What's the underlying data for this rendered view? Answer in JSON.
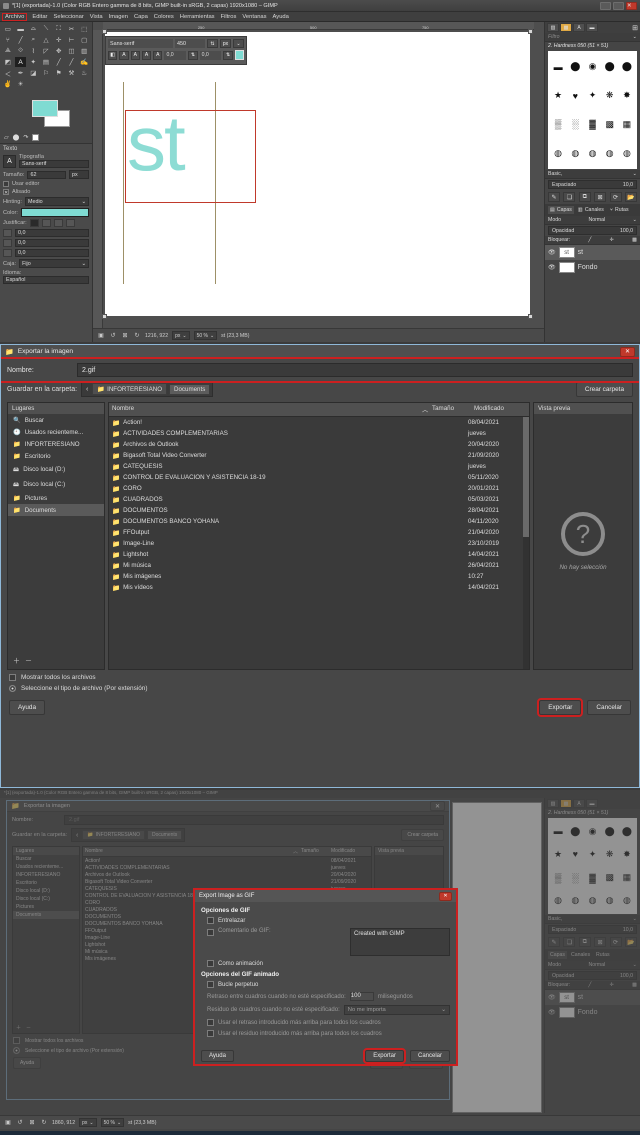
{
  "gimp": {
    "title": "*[1] (exportada)-1.0 (Color RGB Entero gamma de 8 bits, GIMP built-in sRGB, 2 capas) 1920x1080 – GIMP",
    "menus": [
      "Archivo",
      "Editar",
      "Seleccionar",
      "Vista",
      "Imagen",
      "Capa",
      "Colores",
      "Herramientas",
      "Filtros",
      "Ventanas",
      "Ayuda"
    ],
    "highlight_menu": "Archivo",
    "tools": [
      "▭",
      "▬",
      "⬭",
      "⟍",
      "⬚",
      "✂",
      "⛶",
      "⧉",
      "╱",
      "🔍",
      "△",
      "✛",
      "⊢",
      "□",
      "⟁",
      "✎",
      "⌇",
      "↷",
      "✥",
      "◫",
      "▥",
      "⬓",
      "◩",
      "⬛",
      "A",
      "✦",
      "▤",
      "╱",
      "╱",
      "✒",
      "＜",
      "✍",
      "◪",
      "⚐",
      "⚑",
      "⚒",
      "✆",
      "♨",
      "✌"
    ],
    "active_tool": "A",
    "foreground_color": "#7fdbd2",
    "background_color": "#ffffff",
    "tooloptions": {
      "header": "Texto",
      "font_label": "Tipografía",
      "font_value": "Sans-serif",
      "size_label": "Tamaño:",
      "size_value": "62",
      "size_unit": "px",
      "use_editor": "Usar editor",
      "antialias": "Alisado",
      "hinting_label": "Hinting:",
      "hinting_value": "Medio",
      "color_label": "Color:",
      "color_value": "#7fdbd2",
      "justify_label": "Justificar:",
      "indent": "0,0",
      "line_spacing": "0,0",
      "letter_spacing": "0,0",
      "box_label": "Caja:",
      "box_value": "Fijo",
      "language_label": "Idioma:",
      "language_value": "Español"
    },
    "canvas": {
      "ruler_ticks_h": [
        "250",
        "500",
        "750"
      ],
      "text_content": "st",
      "text_color": "#8ddcd4",
      "ontool": {
        "font": "Sans-serif",
        "size": "450",
        "unit": "px",
        "btns": [
          "B",
          "A",
          "A",
          "A",
          "A"
        ],
        "num1": "0,0",
        "num2": "0,0",
        "swatch": "#7fdbd2"
      }
    },
    "statusbar": {
      "coords": "1216, 922",
      "unit": "px",
      "zoom": "50 %",
      "info": "st (23,3 MB)"
    },
    "dock": {
      "brush_name": "2. Hardness 050 (51 × 51)",
      "filter_placeholder": "Filtro",
      "tag_value": "Basic,",
      "spacing_label": "Espaciado",
      "spacing_value": "10,0",
      "tabs": [
        "Capas",
        "Canales",
        "Rutas"
      ],
      "mode_label": "Modo",
      "mode_value": "Normal",
      "opacity_label": "Opacidad",
      "opacity_value": "100,0",
      "lock_label": "Bloquear:",
      "layers": [
        {
          "name": "st",
          "selected": true
        },
        {
          "name": "Fondo",
          "selected": false
        }
      ]
    }
  },
  "export_dialog": {
    "title": "Exportar la imagen",
    "name_label": "Nombre:",
    "name_value": "2.gif",
    "folder_label": "Guardar en la carpeta:",
    "crumbs": [
      "INFORTERESIANO",
      "Documents"
    ],
    "create_folder": "Crear carpeta",
    "places_header": "Lugares",
    "places": [
      {
        "icon": "search-icon",
        "label": "Buscar"
      },
      {
        "icon": "recent-icon",
        "label": "Usados recienteme..."
      },
      {
        "icon": "folder-icon",
        "label": "INFORTERESIANO"
      },
      {
        "icon": "folder-icon",
        "label": "Escritorio"
      },
      {
        "icon": "drive-icon",
        "label": "Disco local (D:)"
      },
      {
        "icon": "drive-icon",
        "label": "Disco local (C:)"
      },
      {
        "icon": "folder-icon",
        "label": "Pictures"
      },
      {
        "icon": "folder-icon",
        "label": "Documents"
      }
    ],
    "selected_place": "Documents",
    "columns": [
      "Nombre",
      "Tamaño",
      "Modificado"
    ],
    "files": [
      {
        "name": "Action!",
        "size": "",
        "modified": "08/04/2021"
      },
      {
        "name": "ACTIVIDADES COMPLEMENTARIAS",
        "size": "",
        "modified": "jueves"
      },
      {
        "name": "Archivos de Outlook",
        "size": "",
        "modified": "20/04/2020"
      },
      {
        "name": "Bigasoft Total Video Converter",
        "size": "",
        "modified": "21/09/2020"
      },
      {
        "name": "CATEQUESIS",
        "size": "",
        "modified": "jueves"
      },
      {
        "name": "CONTROL DE EVALUACION Y ASISTENCIA 18-19",
        "size": "",
        "modified": "05/11/2020"
      },
      {
        "name": "CORO",
        "size": "",
        "modified": "20/01/2021"
      },
      {
        "name": "CUADRADOS",
        "size": "",
        "modified": "05/03/2021"
      },
      {
        "name": "DOCUMENTOS",
        "size": "",
        "modified": "28/04/2021"
      },
      {
        "name": "DOCUMENTOS BANCO YOHANA",
        "size": "",
        "modified": "04/11/2020"
      },
      {
        "name": "FFOutput",
        "size": "",
        "modified": "21/04/2020"
      },
      {
        "name": "Image-Line",
        "size": "",
        "modified": "23/10/2019"
      },
      {
        "name": "Lightshot",
        "size": "",
        "modified": "14/04/2021"
      },
      {
        "name": "Mi música",
        "size": "",
        "modified": "26/04/2021"
      },
      {
        "name": "Mis imágenes",
        "size": "",
        "modified": "10:27"
      },
      {
        "name": "Mis vídeos",
        "size": "",
        "modified": "14/04/2021"
      }
    ],
    "preview_header": "Vista previa",
    "preview_empty": "No hay selección",
    "show_all": "Mostrar todos los archivos",
    "select_type": "Seleccione el tipo de archivo (Por extensión)",
    "help": "Ayuda",
    "export": "Exportar",
    "cancel": "Cancelar"
  },
  "gif_dialog": {
    "title": "Export Image as GIF",
    "section_gif": "Opciones de GIF",
    "interlace": "Entrelazar",
    "comment_label": "Comentario de GIF:",
    "comment_value": "Created with GIMP",
    "as_animation": "Como animación",
    "section_anim": "Opciones del GIF animado",
    "loop": "Bucle perpetuo",
    "delay_label": "Retraso entre cuadros cuando no esté especificado:",
    "delay_value": "100",
    "delay_unit": "milisegundos",
    "disposal_label": "Residuo de cuadros cuando no esté especificado:",
    "disposal_value": "No me importa",
    "use_delay": "Usar el retraso introducido más arriba para todos los cuadros",
    "use_disposal": "Usar el residuo introducido más arriba para todos los cuadros",
    "help": "Ayuda",
    "export": "Exportar",
    "cancel": "Cancelar"
  },
  "panel3": {
    "statusbar": {
      "coords": "1860, 912",
      "unit": "px",
      "zoom": "50 %",
      "info": "st (23,3 MB)"
    }
  }
}
